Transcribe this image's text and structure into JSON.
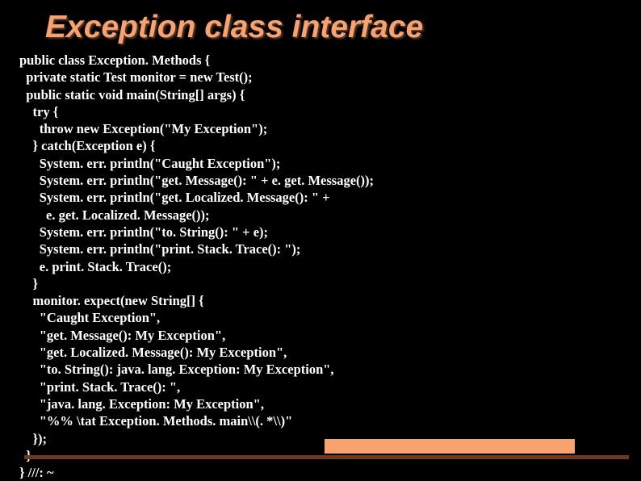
{
  "title": "Exception class interface",
  "code_lines": [
    "public class Exception. Methods {",
    "  private static Test monitor = new Test();",
    "  public static void main(String[] args) {",
    "    try {",
    "      throw new Exception(\"My Exception\");",
    "    } catch(Exception e) {",
    "      System. err. println(\"Caught Exception\");",
    "      System. err. println(\"get. Message(): \" + e. get. Message());",
    "      System. err. println(\"get. Localized. Message(): \" +",
    "        e. get. Localized. Message());",
    "      System. err. println(\"to. String(): \" + e);",
    "      System. err. println(\"print. Stack. Trace(): \");",
    "      e. print. Stack. Trace();",
    "    }",
    "    monitor. expect(new String[] {",
    "      \"Caught Exception\",",
    "      \"get. Message(): My Exception\",",
    "      \"get. Localized. Message(): My Exception\",",
    "      \"to. String(): java. lang. Exception: My Exception\",",
    "      \"print. Stack. Trace(): \",",
    "      \"java. lang. Exception: My Exception\",",
    "      \"%% \\tat Exception. Methods. main\\\\(. *\\\\)\"",
    "    });",
    "  }",
    "} ///: ~"
  ]
}
